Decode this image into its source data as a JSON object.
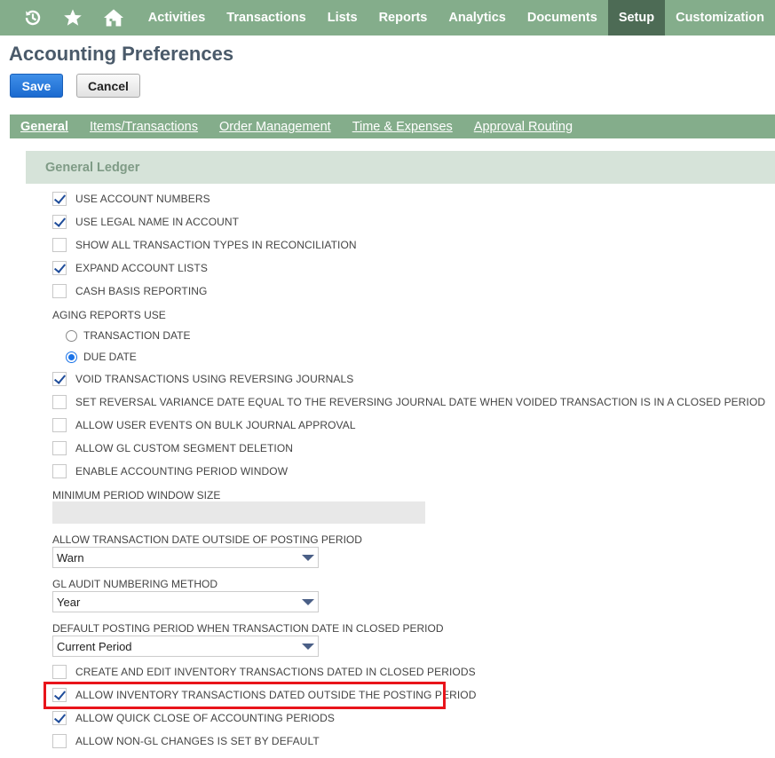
{
  "nav": {
    "icons": [
      "recent-records-icon",
      "star-icon",
      "home-icon"
    ],
    "items": [
      {
        "label": "Activities",
        "active": false
      },
      {
        "label": "Transactions",
        "active": false
      },
      {
        "label": "Lists",
        "active": false
      },
      {
        "label": "Reports",
        "active": false
      },
      {
        "label": "Analytics",
        "active": false
      },
      {
        "label": "Documents",
        "active": false
      },
      {
        "label": "Setup",
        "active": true
      },
      {
        "label": "Customization",
        "active": false
      }
    ]
  },
  "page": {
    "title": "Accounting Preferences",
    "save_label": "Save",
    "cancel_label": "Cancel"
  },
  "tabs": [
    {
      "label": "General",
      "active": true
    },
    {
      "label": "Items/Transactions",
      "active": false
    },
    {
      "label": "Order Management",
      "active": false
    },
    {
      "label": "Time & Expenses",
      "active": false
    },
    {
      "label": "Approval Routing",
      "active": false
    }
  ],
  "section": {
    "title": "General Ledger"
  },
  "prefs": {
    "use_account_numbers": {
      "label": "USE ACCOUNT NUMBERS",
      "checked": true
    },
    "use_legal_name": {
      "label": "USE LEGAL NAME IN ACCOUNT",
      "checked": true
    },
    "show_all_types": {
      "label": "SHOW ALL TRANSACTION TYPES IN RECONCILIATION",
      "checked": false
    },
    "expand_account_lists": {
      "label": "EXPAND ACCOUNT LISTS",
      "checked": true
    },
    "cash_basis": {
      "label": "CASH BASIS REPORTING",
      "checked": false
    },
    "aging_label": "AGING REPORTS USE",
    "aging_transaction_date": {
      "label": "TRANSACTION DATE",
      "selected": false
    },
    "aging_due_date": {
      "label": "DUE DATE",
      "selected": true
    },
    "void_reversing": {
      "label": "VOID TRANSACTIONS USING REVERSING JOURNALS",
      "checked": true
    },
    "reversal_variance": {
      "label": "SET REVERSAL VARIANCE DATE EQUAL TO THE REVERSING JOURNAL DATE WHEN VOIDED TRANSACTION IS IN A CLOSED PERIOD",
      "checked": false
    },
    "user_events_bulk": {
      "label": "ALLOW USER EVENTS ON BULK JOURNAL APPROVAL",
      "checked": false
    },
    "gl_segment_deletion": {
      "label": "ALLOW GL CUSTOM SEGMENT DELETION",
      "checked": false
    },
    "period_window": {
      "label": "ENABLE ACCOUNTING PERIOD WINDOW",
      "checked": false
    },
    "min_window_label": "MINIMUM PERIOD WINDOW SIZE",
    "min_window_value": "",
    "outside_posting_label": "ALLOW TRANSACTION DATE OUTSIDE OF POSTING PERIOD",
    "outside_posting_value": "Warn",
    "gl_audit_label": "GL AUDIT NUMBERING METHOD",
    "gl_audit_value": "Year",
    "default_posting_label": "DEFAULT POSTING PERIOD WHEN TRANSACTION DATE IN CLOSED PERIOD",
    "default_posting_value": "Current Period",
    "inventory_closed": {
      "label": "CREATE AND EDIT INVENTORY TRANSACTIONS DATED IN CLOSED PERIODS",
      "checked": false
    },
    "inventory_outside": {
      "label": "ALLOW INVENTORY TRANSACTIONS DATED OUTSIDE THE POSTING PERIOD",
      "checked": true
    },
    "quick_close": {
      "label": "ALLOW QUICK CLOSE OF ACCOUNTING PERIODS",
      "checked": true
    },
    "non_gl_changes": {
      "label": "ALLOW NON-GL CHANGES IS SET BY DEFAULT",
      "checked": false
    }
  },
  "colors": {
    "nav_bg": "#84ad8b",
    "nav_active": "#4d6b55",
    "highlight": "#e8141b",
    "primary_button": "#1b6ad0"
  }
}
